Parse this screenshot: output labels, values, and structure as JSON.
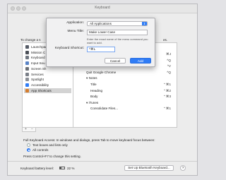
{
  "window": {
    "title": "Keyboard"
  },
  "intro_text": "To change a s",
  "sidebar": {
    "items": [
      {
        "label": "Launchpad",
        "color": "#555b66"
      },
      {
        "label": "Mission C",
        "color": "#4a4f57"
      },
      {
        "label": "Keyboard",
        "color": "#6f7680"
      },
      {
        "label": "Input Sou",
        "color": "#5a84c6"
      },
      {
        "label": "Screen Sh",
        "color": "#6b6f75"
      },
      {
        "label": "Services",
        "color": "#7a7f88"
      },
      {
        "label": "Spotlight",
        "color": "#8b8f96"
      },
      {
        "label": "Accessibility",
        "color": "#2f7cf6"
      },
      {
        "label": "App Shortcuts",
        "color": "#d57d2e",
        "selected": true
      }
    ]
  },
  "shortcuts": {
    "header_fragment": "es.",
    "rows": [
      {
        "name": "",
        "key": "⌘J"
      },
      {
        "name": "",
        "key": "^Q"
      },
      {
        "name": "",
        "key": "^V"
      },
      {
        "name": "Quit Google Chrome",
        "key": "^Q"
      },
      {
        "name": "▾ Notes",
        "key": ""
      },
      {
        "name": "Title",
        "key": "⌃⌘1",
        "indent": true
      },
      {
        "name": "Heading",
        "key": "⌃⌘2",
        "indent": true
      },
      {
        "name": "Body",
        "key": "⌃⌘3",
        "indent": true
      },
      {
        "name": "▾ iTunes",
        "key": ""
      },
      {
        "name": "Consolidate Files...",
        "key": "⌃⌘1",
        "indent": true
      }
    ],
    "add_label": "+",
    "remove_label": "−"
  },
  "keyboard_access": {
    "text": "Full Keyboard Access: In windows and dialogs, press Tab to move keyboard focus between:",
    "options": [
      {
        "label": "Text boxes and lists only",
        "selected": false
      },
      {
        "label": "All controls",
        "selected": true
      }
    ],
    "footnote": "Press Control+F7 to change this setting."
  },
  "footer": {
    "battery_label": "Keyboard battery level:",
    "battery_value": "22 %",
    "bluetooth_button": "Set Up Bluetooth Keyboard...",
    "help": "?"
  },
  "dialog": {
    "application_label": "Application:",
    "application_value": "All Applications",
    "menu_title_label": "Menu Title:",
    "menu_title_value": "Make Lower Case",
    "hint": "Enter the exact name of the menu command you want to add.",
    "shortcut_label": "Keyboard Shortcut:",
    "shortcut_value": "^⌘L",
    "cancel": "Cancel",
    "add": "Add"
  }
}
